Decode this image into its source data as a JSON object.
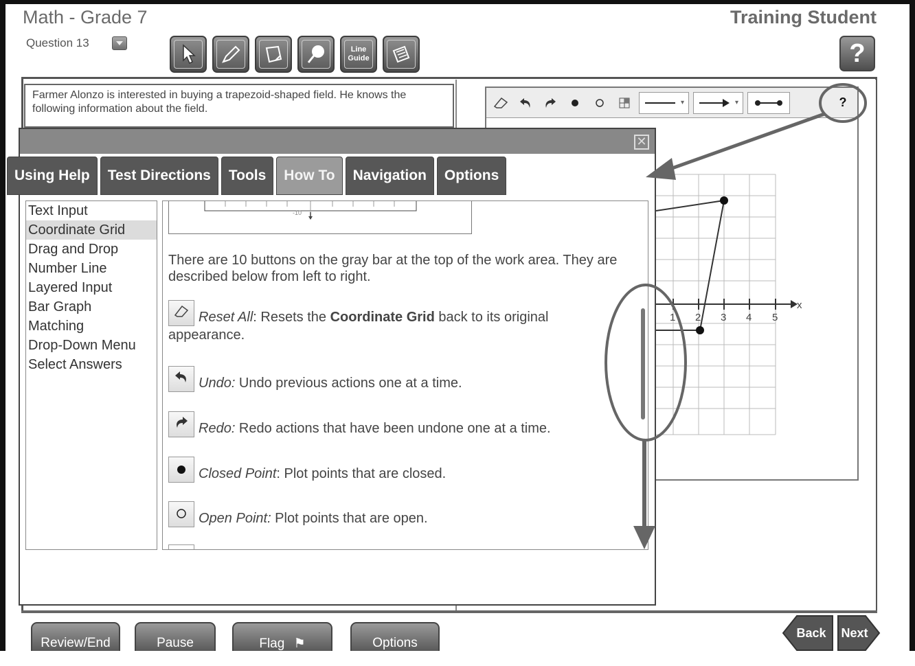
{
  "header": {
    "title": "Math - Grade 7",
    "question_label": "Question 13",
    "user": "Training Student",
    "help": "?"
  },
  "tools": [
    {
      "name": "pointer",
      "label": ""
    },
    {
      "name": "highlighter",
      "label": ""
    },
    {
      "name": "notepad",
      "label": ""
    },
    {
      "name": "magnifier",
      "label": ""
    },
    {
      "name": "line-guide",
      "label": "Line Guide"
    },
    {
      "name": "calculator",
      "label": ""
    }
  ],
  "passage": {
    "text": "Farmer Alonzo is interested in buying a trapezoid-shaped field. He knows the following information about the field."
  },
  "grid_toolbar": {
    "help": "?",
    "icons": [
      "eraser-icon",
      "undo-icon",
      "redo-icon",
      "closed-point-icon",
      "open-point-icon",
      "grid-icon"
    ]
  },
  "coordinate_grid": {
    "x_label": "x",
    "tick_labels": [
      "1",
      "2",
      "3",
      "4",
      "5"
    ]
  },
  "dialog": {
    "tabs": [
      "Using Help",
      "Test Directions",
      "Tools",
      "How To",
      "Navigation",
      "Options"
    ],
    "active_tab": "How To",
    "topics": [
      "Text Input",
      "Coordinate Grid",
      "Drag and Drop",
      "Number Line",
      "Layered Input",
      "Bar Graph",
      "Matching",
      "Drop-Down Menu",
      "Select Answers"
    ],
    "selected_topic": "Coordinate Grid",
    "ruler_label": "-10",
    "intro": "There are 10 buttons on the gray bar at the top of the work area. They are described below from left to right.",
    "items": [
      {
        "icon": "eraser-icon",
        "title": "Reset All",
        "sep": ": Resets the ",
        "bold": "Coordinate Grid",
        "rest": " back to its original appearance."
      },
      {
        "icon": "undo-icon",
        "title": "Undo:",
        "rest": " Undo previous actions one at a time."
      },
      {
        "icon": "redo-icon",
        "title": "Redo:",
        "rest": " Redo actions that have been undone one at a time."
      },
      {
        "icon": "closed-point-icon",
        "title": "Closed Point",
        "rest": ": Plot points that are closed."
      },
      {
        "icon": "open-point-icon",
        "title": "Open Point:",
        "rest": " Plot points that are open."
      }
    ]
  },
  "bottom": {
    "review": "Review/End Test",
    "pause": "Pause",
    "flag": "Flag",
    "options": "Options",
    "back": "Back",
    "next": "Next"
  }
}
